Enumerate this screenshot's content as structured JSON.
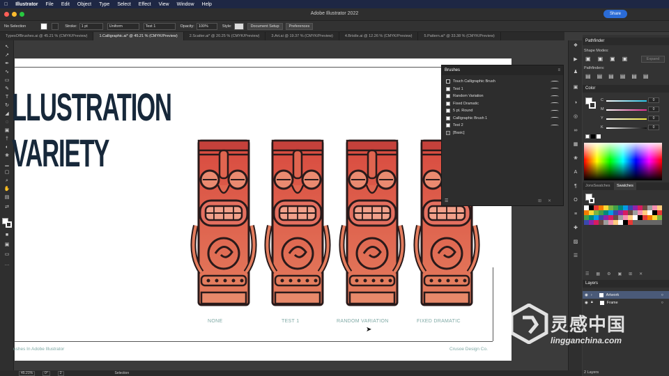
{
  "menubar": {
    "app": "Illustrator",
    "items": [
      "File",
      "Edit",
      "Object",
      "Type",
      "Select",
      "Effect",
      "View",
      "Window",
      "Help"
    ]
  },
  "window": {
    "title": "Adobe Illustrator 2022",
    "share_label": "Share"
  },
  "control_bar": {
    "selection": "No Selection",
    "stroke_label": "Stroke:",
    "stroke_value": "1 pt",
    "profile": "Uniform",
    "brush": "Test 1",
    "opacity_label": "Opacity:",
    "opacity_value": "100%",
    "style_label": "Style:",
    "document_setup": "Document Setup",
    "preferences": "Preferences"
  },
  "tabs": [
    {
      "label": "TypesOfBrushes.ai @ 45.21 % (CMYK/Preview)",
      "active": false
    },
    {
      "label": "1.Calligraphic.ai* @ 45.21 % (CMYK/Preview)",
      "active": true
    },
    {
      "label": "2.Scatter.ai* @ 20.25 % (CMYK/Preview)",
      "active": false
    },
    {
      "label": "3.Art.ai @ 19.37 % (CMYK/Preview)",
      "active": false
    },
    {
      "label": "4.Bristle.ai @ 12.26 % (CMYK/Preview)",
      "active": false
    },
    {
      "label": "5.Pattern.ai* @ 33.38 % (CMYK/Preview)",
      "active": false
    }
  ],
  "artboard": {
    "title_line1": "LLUSTRATION",
    "title_line2": "VARIETY",
    "captions": [
      "NONE",
      "TEST 1",
      "RANDOM VARIATION",
      "FIXED DRAMATIC"
    ],
    "footer_left": "ushes In Adobe Illustrator",
    "footer_right": "Crusoe Design Co."
  },
  "brushes_panel": {
    "title": "Brushes",
    "items": [
      "Touch Calligraphic Brush",
      "Test 1",
      "Random Variation",
      "Fixed Dramatic",
      "5 pt. Round",
      "Calligraphic Brush 1",
      "Test 2",
      "[Basic]"
    ]
  },
  "pathfinder_panel": {
    "title": "Pathfinder",
    "shape_modes": "Shape Modes:",
    "pathfinders": "Pathfinders:",
    "expand": "Expand"
  },
  "color_panel": {
    "title": "Color",
    "channels": [
      {
        "label": "C",
        "value": "0",
        "color": "#27c4e8"
      },
      {
        "label": "M",
        "value": "0",
        "color": "#e42a8c"
      },
      {
        "label": "Y",
        "value": "0",
        "color": "#f3e83a"
      },
      {
        "label": "K",
        "value": "0",
        "color": "#888888"
      }
    ]
  },
  "swatches_panel": {
    "tabs": [
      "JonsSwatches",
      "Swatches"
    ]
  },
  "layers_panel": {
    "title": "Layers",
    "layers": [
      "Artwork",
      "Frame"
    ],
    "count": "2 Layers"
  },
  "status": {
    "zoom": "45.21%",
    "rotation": "0°",
    "artboard": "2",
    "tool": "Selection"
  },
  "watermark": {
    "cn": "灵感中国",
    "url": "lingganchina.com"
  }
}
